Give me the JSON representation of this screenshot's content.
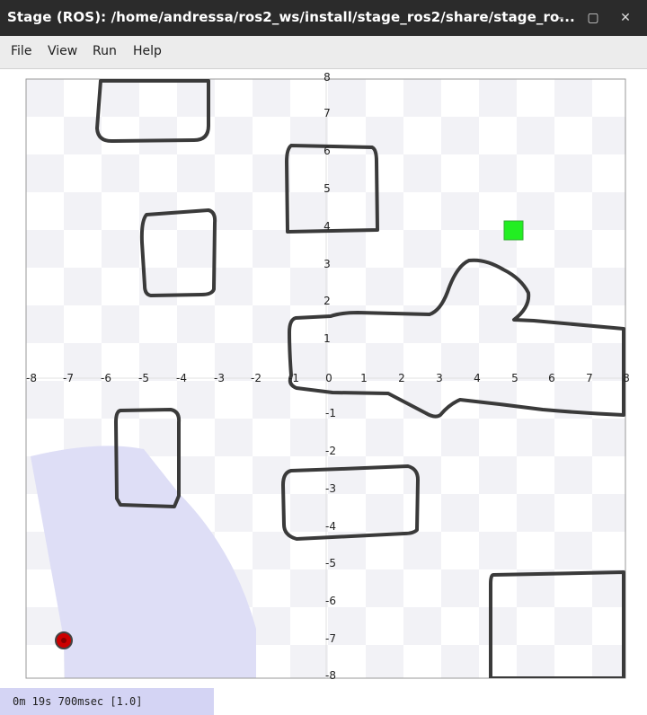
{
  "window": {
    "title": "Stage (ROS): /home/andressa/ros2_ws/install/stage_ros2/share/stage_ro...",
    "minimize_glyph": "–",
    "maximize_glyph": "▢",
    "close_glyph": "✕"
  },
  "menu": {
    "file": "File",
    "view": "View",
    "run": "Run",
    "help": "Help"
  },
  "axes": {
    "x_ticks": [
      "-8",
      "-7",
      "-6",
      "-5",
      "-4",
      "-3",
      "-2",
      "-1",
      "0",
      "1",
      "2",
      "3",
      "4",
      "5",
      "6",
      "7",
      "8"
    ],
    "y_ticks": [
      "8",
      "7",
      "6",
      "5",
      "4",
      "3",
      "2",
      "1",
      "0",
      "-1",
      "-2",
      "-3",
      "-4",
      "-5",
      "-6",
      "-7",
      "-8"
    ]
  },
  "status": {
    "time": "0m 19s 700msec [1.0]"
  },
  "colors": {
    "obstacle": "#3a3a3a",
    "goal": "#22ee22",
    "robot": "#cc0000",
    "laser": "#dcdcf6"
  }
}
